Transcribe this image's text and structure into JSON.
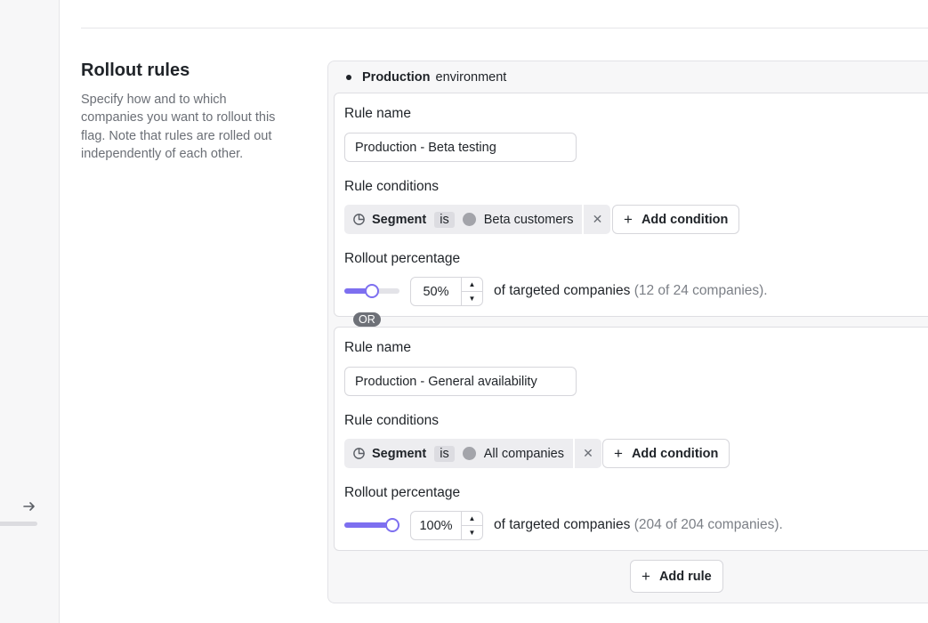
{
  "section": {
    "title": "Rollout rules",
    "description": "Specify how and to which companies you want to rollout this flag. Note that rules are rolled out independently of each other."
  },
  "environment": {
    "name": "Production",
    "suffix": "environment"
  },
  "labels": {
    "rule_name": "Rule name",
    "rule_conditions": "Rule conditions",
    "rollout_percentage": "Rollout percentage",
    "add_condition": "Add condition",
    "targeted_companies": "of targeted companies",
    "or": "OR",
    "add_rule": "Add rule"
  },
  "rules": [
    {
      "name": "Production - Beta testing",
      "condition": {
        "field": "Segment",
        "operator": "is",
        "value": "Beta customers"
      },
      "percentage": 50,
      "percentage_text": "50%",
      "count_text": "(12 of 24 companies)."
    },
    {
      "name": "Production - General availability",
      "condition": {
        "field": "Segment",
        "operator": "is",
        "value": "All companies"
      },
      "percentage": 100,
      "percentage_text": "100%",
      "count_text": "(204 of 204 companies)."
    }
  ],
  "colors": {
    "accent": "#7d6ff0",
    "muted_text": "#6b6f76",
    "segment_dot": "#a3a4aa"
  },
  "icons": {
    "segment": "pie-chart-icon",
    "remove": "close-icon",
    "add": "plus-icon",
    "collapse": "arrow-right-icon",
    "environment": "dot-icon"
  }
}
